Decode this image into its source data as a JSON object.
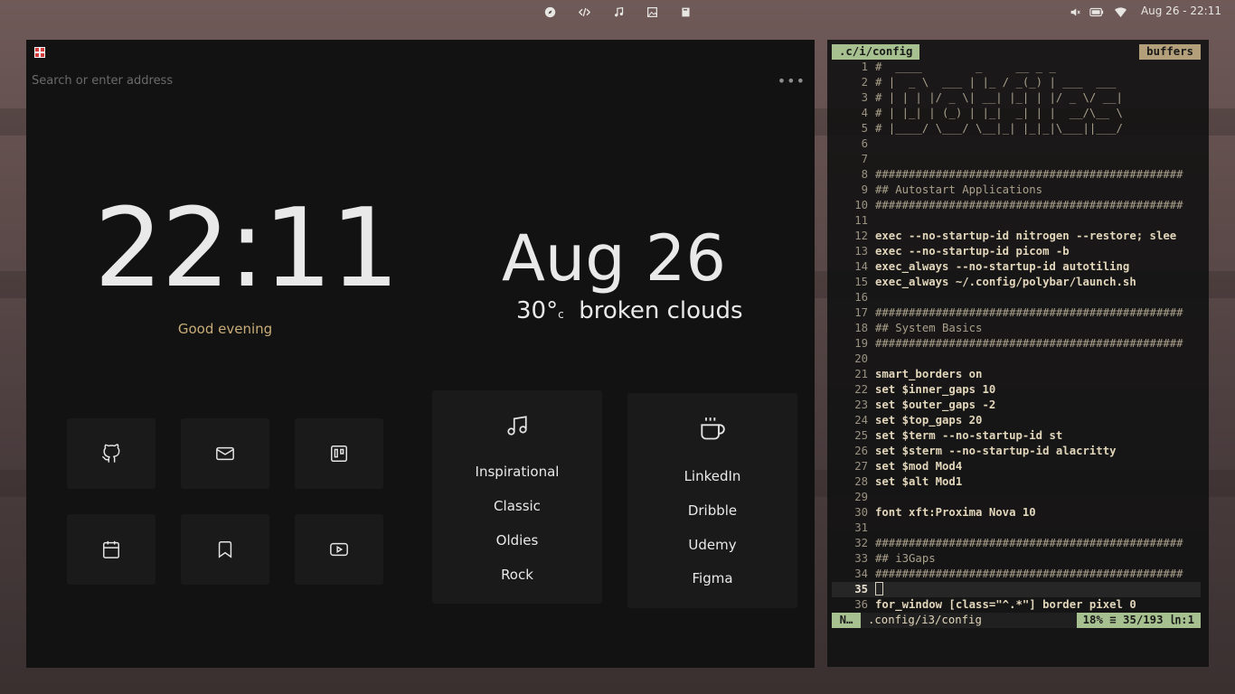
{
  "topbar": {
    "workspaces": [
      {
        "icon": "compass-icon"
      },
      {
        "icon": "code-icon"
      },
      {
        "icon": "music-note-icon"
      },
      {
        "icon": "image-icon"
      },
      {
        "icon": "book-icon"
      }
    ],
    "tray": [
      "volume-icon",
      "battery-icon",
      "wifi-icon"
    ],
    "datetime": "Aug 26 - 22:11"
  },
  "browser": {
    "address_placeholder": "Search or enter address",
    "time": "22:11",
    "greeting": "Good evening",
    "date": "Aug 26",
    "temperature": "30°",
    "temp_unit": "c",
    "weather": "broken clouds",
    "quick_links": [
      {
        "icon": "github-icon"
      },
      {
        "icon": "mail-icon"
      },
      {
        "icon": "trello-icon"
      },
      {
        "icon": "calendar-icon"
      },
      {
        "icon": "bookmark-icon"
      },
      {
        "icon": "youtube-icon"
      }
    ],
    "music_card": {
      "icon": "music-note-icon",
      "links": [
        "Inspirational",
        "Classic",
        "Oldies",
        "Rock"
      ]
    },
    "work_card": {
      "icon": "coffee-icon",
      "links": [
        "LinkedIn",
        "Dribble",
        "Udemy",
        "Figma"
      ]
    },
    "colors": {
      "accent": "#c9ad78",
      "background": "#121212",
      "tile": "#1a1a1a"
    }
  },
  "terminal": {
    "tab_left": ".c/i/config",
    "tab_right": "buffers",
    "lines": [
      {
        "n": "1",
        "t": "#  ____        _     __ _ _",
        "s": "cm"
      },
      {
        "n": "2",
        "t": "# |  _ \\  ___ | |_ / _(_) | ___  ___",
        "s": "cm"
      },
      {
        "n": "3",
        "t": "# | | | |/ _ \\| __| |_| | |/ _ \\/ __|",
        "s": "cm"
      },
      {
        "n": "4",
        "t": "# | |_| | (_) | |_|  _| | |  __/\\__ \\",
        "s": "cm"
      },
      {
        "n": "5",
        "t": "# |____/ \\___/ \\__|_| |_|_|\\___||___/",
        "s": "cm"
      },
      {
        "n": "6",
        "t": "",
        "s": "cm"
      },
      {
        "n": "7",
        "t": "",
        "s": "cm"
      },
      {
        "n": "8",
        "t": "##############################################",
        "s": "cm"
      },
      {
        "n": "9",
        "t": "## Autostart Applications",
        "s": "cm"
      },
      {
        "n": "10",
        "t": "##############################################",
        "s": "cm"
      },
      {
        "n": "11",
        "t": "",
        "s": "cm"
      },
      {
        "n": "12",
        "t": "exec --no-startup-id nitrogen --restore; slee",
        "s": "kw"
      },
      {
        "n": "13",
        "t": "exec --no-startup-id picom -b",
        "s": "kw"
      },
      {
        "n": "14",
        "t": "exec_always --no-startup-id autotiling",
        "s": "kw"
      },
      {
        "n": "15",
        "t": "exec_always ~/.config/polybar/launch.sh",
        "s": "kw"
      },
      {
        "n": "16",
        "t": "",
        "s": "cm"
      },
      {
        "n": "17",
        "t": "##############################################",
        "s": "cm"
      },
      {
        "n": "18",
        "t": "## System Basics",
        "s": "cm"
      },
      {
        "n": "19",
        "t": "##############################################",
        "s": "cm"
      },
      {
        "n": "20",
        "t": "",
        "s": "cm"
      },
      {
        "n": "21",
        "t": "smart_borders on",
        "s": "kw"
      },
      {
        "n": "22",
        "t": "set $inner_gaps 10",
        "s": "kw"
      },
      {
        "n": "23",
        "t": "set $outer_gaps -2",
        "s": "kw"
      },
      {
        "n": "24",
        "t": "set $top_gaps 20",
        "s": "kw"
      },
      {
        "n": "25",
        "t": "set $term --no-startup-id st",
        "s": "kw"
      },
      {
        "n": "26",
        "t": "set $sterm --no-startup-id alacritty",
        "s": "kw"
      },
      {
        "n": "27",
        "t": "set $mod Mod4",
        "s": "kw"
      },
      {
        "n": "28",
        "t": "set $alt Mod1",
        "s": "kw"
      },
      {
        "n": "29",
        "t": "",
        "s": "cm"
      },
      {
        "n": "30",
        "t": "font xft:Proxima Nova 10",
        "s": "kw"
      },
      {
        "n": "31",
        "t": "",
        "s": "cm"
      },
      {
        "n": "32",
        "t": "##############################################",
        "s": "cm"
      },
      {
        "n": "33",
        "t": "## i3Gaps",
        "s": "cm"
      },
      {
        "n": "34",
        "t": "##############################################",
        "s": "cm"
      },
      {
        "n": "35",
        "t": "",
        "s": "cur"
      },
      {
        "n": "36",
        "t": "for_window [class=\"^.*\"] border pixel 0",
        "s": "kw"
      }
    ],
    "status": {
      "mode": "N…",
      "file": ".config/i3/config",
      "position": "18% ≡ 35/193 ㏑:1"
    }
  }
}
